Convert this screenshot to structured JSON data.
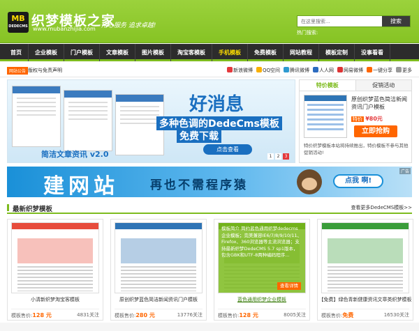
{
  "header": {
    "logo_mark": "MB",
    "logo_sub": "DEDECMS",
    "site_title": "织梦模板之家",
    "site_url": "www.mubanzhijia.com",
    "slogan": "用心服务 追求卓越!",
    "search_placeholder": "在这里搜索...",
    "search_button": "搜索",
    "hot_label": "热门搜索:"
  },
  "nav": {
    "items": [
      "首页",
      "企业模板",
      "门户模板",
      "文章模板",
      "图片模板",
      "淘宝客模板",
      "手机模板",
      "免费模板",
      "网站教程",
      "模板定制",
      "没事看看"
    ],
    "active_index": 6
  },
  "subbar": {
    "notice_tag": "网站公告",
    "notice_text": "版权与免责声明",
    "share": [
      "新浪微博",
      "QQ空间",
      "腾讯微博",
      "人人网",
      "网易微博",
      "一键分享",
      "更多"
    ]
  },
  "banner": {
    "headline": "好消息",
    "line1": "多种色调的DedeCms模板",
    "line2": "免费下载",
    "product": "简洁文章资讯 v2.0",
    "button": "点击查看",
    "pages": [
      "1",
      "2",
      "3"
    ],
    "active_page": 2
  },
  "promo": {
    "tabs": [
      "特价模板",
      "促销活动"
    ],
    "active_tab": 0,
    "title": "原创织梦蓝色简洁新闻资讯门户模板",
    "price_tag": "特价",
    "price": "¥80元",
    "buy_button": "立即抢购",
    "desc": "特价织梦模板本站将持续推出，特价模板不参与其他促销活动!"
  },
  "ad": {
    "big_text": "建网站",
    "mid_text": "再也不需程序猿",
    "button": "点我 啊!",
    "tag": "广告"
  },
  "section": {
    "title": "最新织梦模板",
    "more": "查看更多DedeCMS模板>>"
  },
  "cards": [
    {
      "title": "小清新织梦淘宝客模板",
      "price_label": "模板售价:",
      "price": "128 元",
      "views": "4831关注",
      "accent": "#e74c3c"
    },
    {
      "title": "原创织梦蓝色简洁新闻资讯门户模板",
      "price_label": "模板售价:",
      "price": "280 元",
      "views": "13776关注",
      "accent": "#2e74b5"
    },
    {
      "title": "蓝色通用织梦企业模板",
      "price_label": "模板售价:",
      "price": "128 元",
      "views": "8005关注",
      "accent": "#3a7d0c",
      "overlay": "模板简介\n简约蓝色通用织梦dedecms企业模板；完美兼容IE6/7/8/9/10/11、Firefox、360浏览器等主流浏览器；支持最新织梦DedeCMS 5.7 sp1版本，包含GBK和UTF-8两种编码程序...",
      "overlay_more": "查看详情"
    },
    {
      "title": "【免费】绿色青新健康资讯文章类织梦模板",
      "price_label": "模板售价:",
      "price": "免费",
      "views": "16530关注",
      "accent": "#3a9d3a"
    }
  ]
}
